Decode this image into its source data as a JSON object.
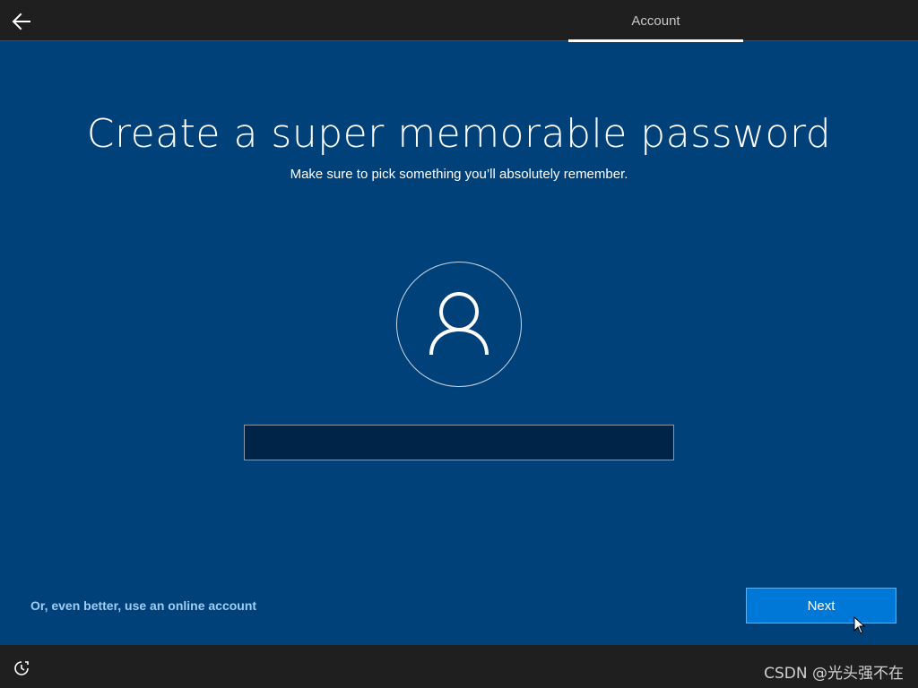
{
  "header": {
    "back_icon": "arrow-left-icon",
    "tab_label": "Account"
  },
  "main": {
    "title": "Create a super memorable password",
    "subtitle": "Make sure to pick something you’ll absolutely remember.",
    "avatar_icon": "user-icon",
    "password": {
      "value": "",
      "placeholder": ""
    }
  },
  "footer": {
    "online_account_link": "Or, even better, use an online account",
    "next_label": "Next"
  },
  "bottom_bar": {
    "ease_of_access_icon": "ease-of-access-icon",
    "watermark": "CSDN @光头强不在"
  },
  "colors": {
    "background": "#00417a",
    "bar": "#1f1f1f",
    "accent": "#0078d7",
    "link": "#9ecdf5"
  }
}
